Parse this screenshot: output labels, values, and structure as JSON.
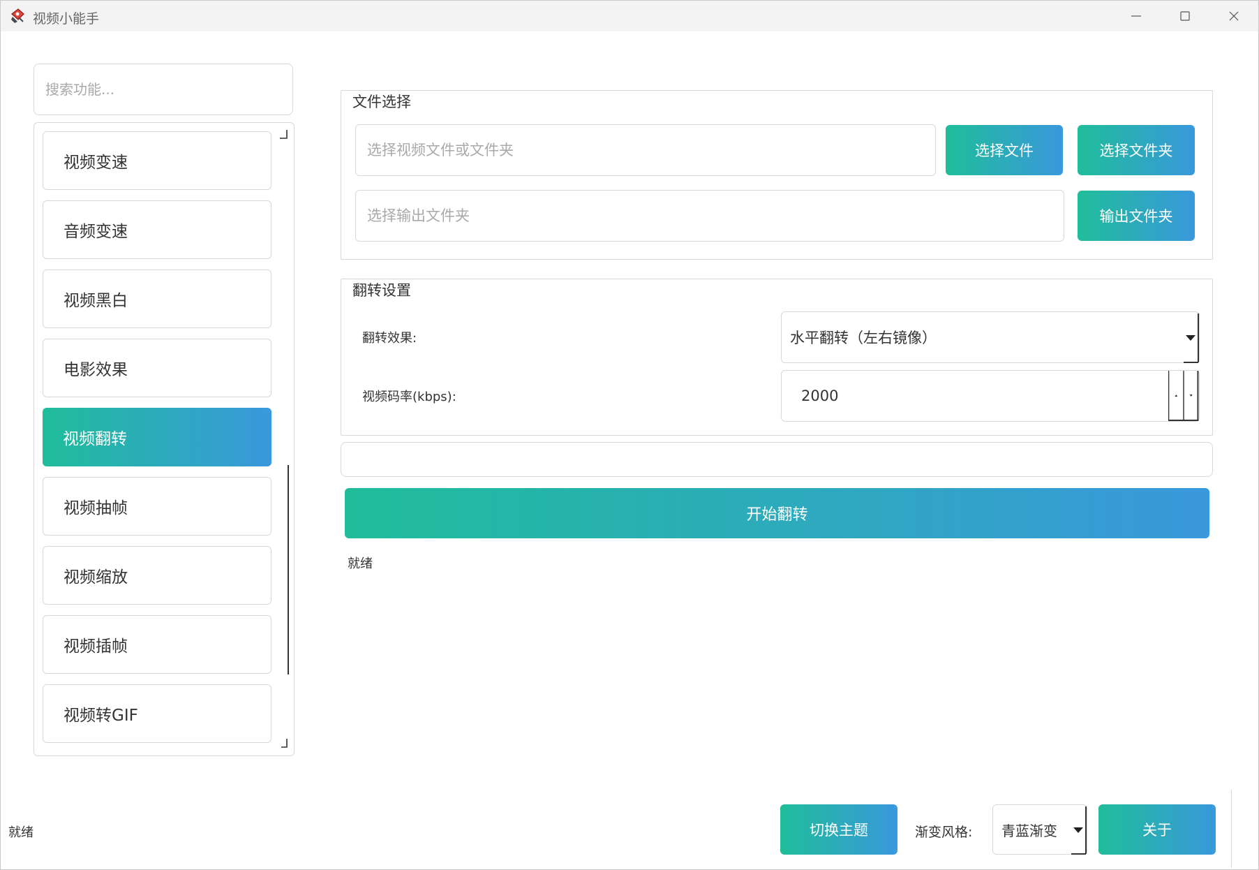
{
  "window": {
    "title": "视频小能手"
  },
  "sidebar": {
    "search_placeholder": "搜索功能...",
    "items": [
      {
        "label": "视频变速",
        "active": false
      },
      {
        "label": "音频变速",
        "active": false
      },
      {
        "label": "视频黑白",
        "active": false
      },
      {
        "label": "电影效果",
        "active": false
      },
      {
        "label": "视频翻转",
        "active": true
      },
      {
        "label": "视频抽帧",
        "active": false
      },
      {
        "label": "视频缩放",
        "active": false
      },
      {
        "label": "视频插帧",
        "active": false
      },
      {
        "label": "视频转GIF",
        "active": false
      }
    ]
  },
  "file_group": {
    "title": "文件选择",
    "input_placeholder": "选择视频文件或文件夹",
    "select_file_label": "选择文件",
    "select_folder_label": "选择文件夹",
    "output_placeholder": "选择输出文件夹",
    "output_folder_label": "输出文件夹"
  },
  "flip_group": {
    "title": "翻转设置",
    "effect_label": "翻转效果:",
    "effect_value": "水平翻转（左右镜像）",
    "bitrate_label": "视频码率(kbps):",
    "bitrate_value": "2000"
  },
  "actions": {
    "start_label": "开始翻转",
    "status": "就绪"
  },
  "footer": {
    "status": "就绪",
    "theme_button_label": "切换主题",
    "gradient_style_label": "渐变风格:",
    "gradient_style_value": "青蓝渐变",
    "about_label": "关于"
  },
  "colors": {
    "gradient_start": "#1fbd9a",
    "gradient_end": "#3a98dc",
    "border": "#d8d8d8",
    "titlebar": "#f3f3f3"
  }
}
